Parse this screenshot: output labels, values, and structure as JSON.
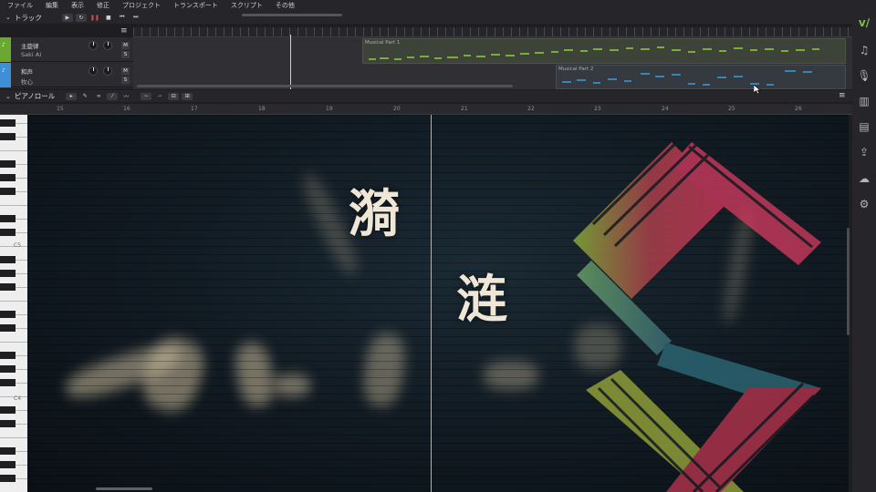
{
  "menubar": {
    "items": [
      "ファイル",
      "編集",
      "表示",
      "修正",
      "プロジェクト",
      "トランスポート",
      "スクリプト",
      "その他"
    ]
  },
  "track_panel": {
    "title": "トラック",
    "tracks": [
      {
        "name": "主旋律",
        "singer": "Saki AI",
        "color": "#6ba832",
        "mute": "M",
        "solo": "S"
      },
      {
        "name": "和声",
        "singer": "牧心",
        "color": "#3f8fd6",
        "mute": "M",
        "solo": "S"
      }
    ],
    "parts": [
      {
        "label": "Musical Part 1",
        "color": "#8fd13a"
      },
      {
        "label": "Musical Part 2",
        "color": "#3a9ce0"
      }
    ]
  },
  "piano_roll": {
    "title": "ピアノロール",
    "ruler_ticks": [
      "15",
      "16",
      "17",
      "18",
      "19",
      "20",
      "21",
      "22",
      "23",
      "24",
      "25",
      "26"
    ],
    "note_labels": [
      "C5",
      "C4"
    ]
  },
  "overlay": {
    "char_1": "漪",
    "char_2": "涟"
  },
  "icons": {
    "logo": "synthv-logo-icon",
    "sidebar": [
      "music-note-icon",
      "microphone-icon",
      "library-icon",
      "document-icon",
      "export-icon",
      "cloud-icon",
      "gear-icon"
    ]
  }
}
